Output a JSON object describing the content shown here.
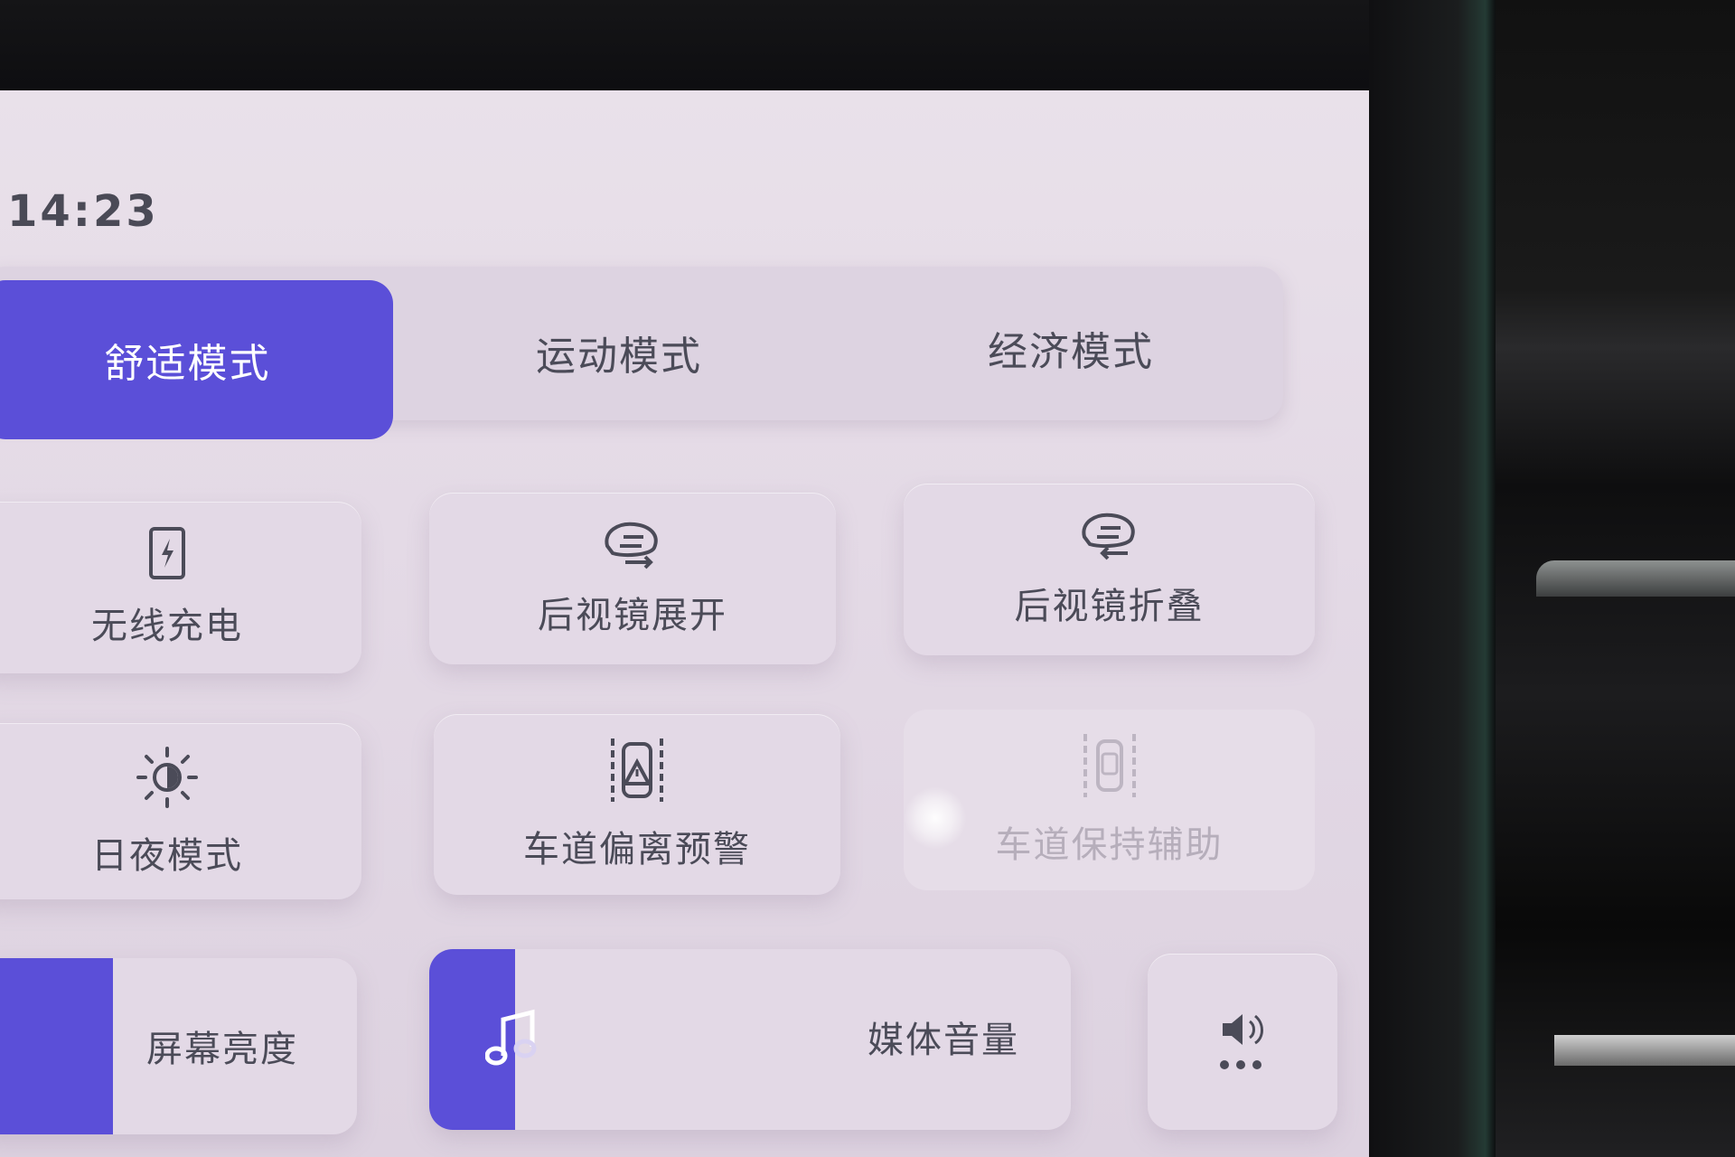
{
  "status": {
    "time": "14:23"
  },
  "drive_modes": {
    "selected": "舒适模式",
    "items": [
      {
        "label": "舒适模式",
        "active": true
      },
      {
        "label": "运动模式",
        "active": false
      },
      {
        "label": "经济模式",
        "active": false
      }
    ]
  },
  "tiles": {
    "wireless_charging": {
      "label": "无线充电",
      "icon": "wireless-charging-icon"
    },
    "mirror_unfold": {
      "label": "后视镜展开",
      "icon": "mirror-unfold-icon"
    },
    "mirror_fold": {
      "label": "后视镜折叠",
      "icon": "mirror-fold-icon"
    },
    "day_night": {
      "label": "日夜模式",
      "icon": "sun-icon"
    },
    "lane_departure": {
      "label": "车道偏离预警",
      "icon": "lane-departure-icon"
    },
    "lane_keep": {
      "label": "车道保持辅助",
      "icon": "lane-keep-icon",
      "enabled": false
    }
  },
  "sliders": {
    "brightness": {
      "label": "屏幕亮度",
      "level": 0.3
    },
    "media_volume": {
      "label": "媒体音量",
      "level": 0.13,
      "icon": "music-note-icon"
    }
  },
  "volume_more": {
    "icon": "speaker-more-icon"
  },
  "colors": {
    "accent": "#5b4fd8",
    "background": "#e6dde8",
    "text": "#4b4b58"
  }
}
